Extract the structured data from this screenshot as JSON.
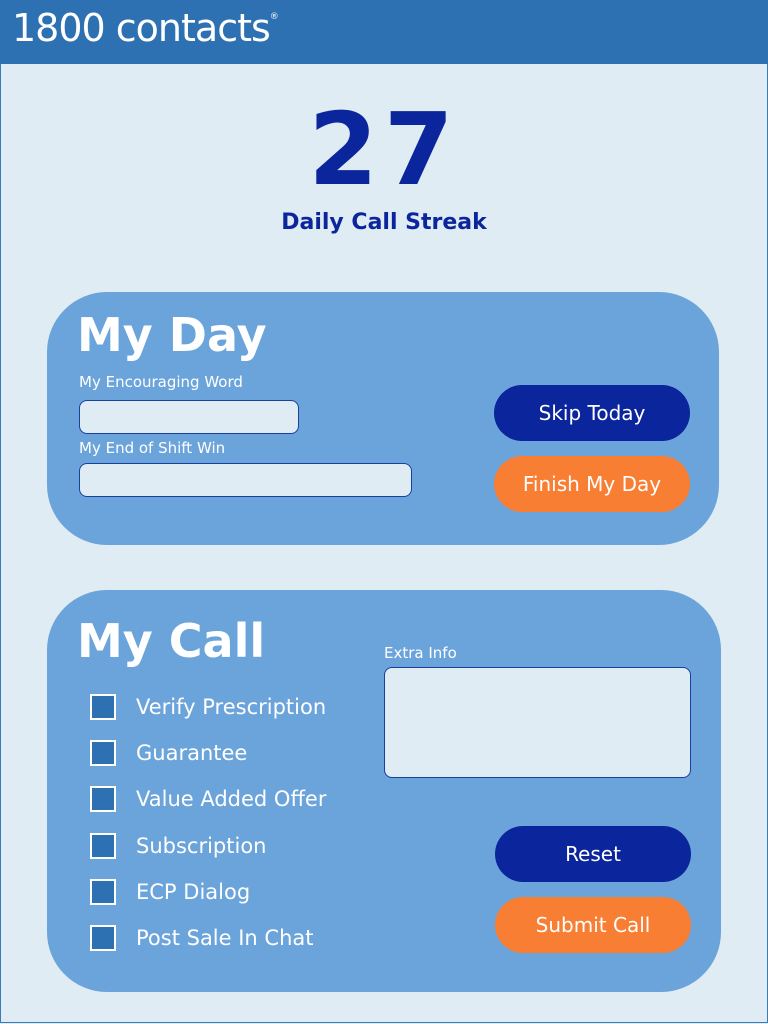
{
  "header": {
    "logo_text": "1800 contacts",
    "logo_mark": "®",
    "brand_color": "#2e71b3"
  },
  "streak": {
    "count": "27",
    "label": "Daily Call Streak"
  },
  "my_day": {
    "title": "My Day",
    "encouraging_word_label": "My Encouraging Word",
    "encouraging_word_value": "",
    "end_of_shift_win_label": "My End of Shift Win",
    "end_of_shift_win_value": "",
    "skip_button": "Skip Today",
    "finish_button": "Finish My Day"
  },
  "my_call": {
    "title": "My Call",
    "extra_info_label": "Extra Info",
    "extra_info_value": "",
    "checklist": [
      {
        "label": "Verify Prescription",
        "checked": false
      },
      {
        "label": "Guarantee",
        "checked": false
      },
      {
        "label": "Value Added Offer",
        "checked": false
      },
      {
        "label": "Subscription",
        "checked": false
      },
      {
        "label": "ECP Dialog",
        "checked": false
      },
      {
        "label": "Post Sale In Chat",
        "checked": false
      }
    ],
    "reset_button": "Reset",
    "submit_button": "Submit Call"
  },
  "colors": {
    "background": "#dfecf3",
    "card": "#6ba4db",
    "navy": "#0b259c",
    "orange": "#f77e33"
  }
}
